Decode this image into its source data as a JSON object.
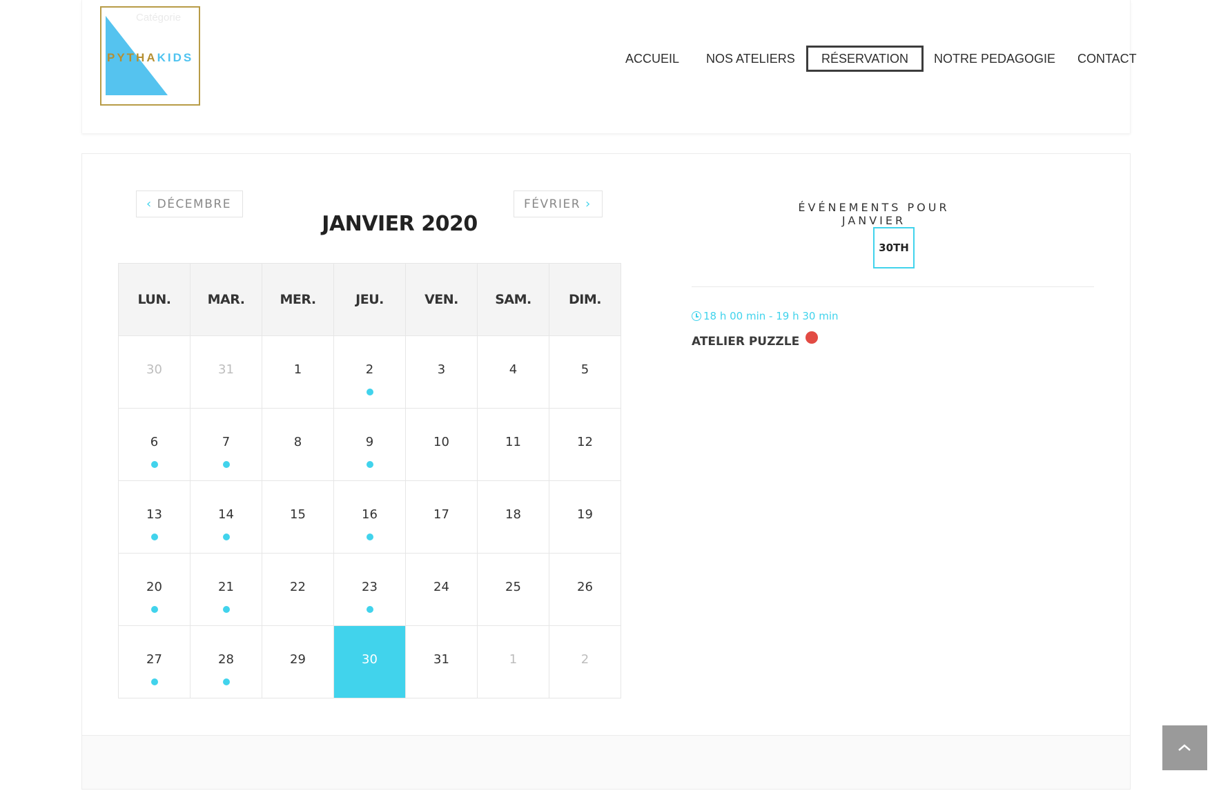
{
  "logo": {
    "faint_text": "Catégorie",
    "text_gold": "PYTHA",
    "text_blue": "KIDS"
  },
  "nav": {
    "items": [
      {
        "label": "ACCUEIL"
      },
      {
        "label": "NOS ATELIERS"
      },
      {
        "label": "RÉSERVATION"
      },
      {
        "label": "NOTRE PEDAGOGIE"
      },
      {
        "label": "CONTACT"
      }
    ]
  },
  "calendar": {
    "prev_label": "DÉCEMBRE",
    "next_label": "FÉVRIER",
    "title": "JANVIER 2020",
    "weekdays": [
      "LUN.",
      "MAR.",
      "MER.",
      "JEU.",
      "VEN.",
      "SAM.",
      "DIM."
    ],
    "weeks": [
      [
        {
          "d": "30",
          "muted": true
        },
        {
          "d": "31",
          "muted": true
        },
        {
          "d": "1"
        },
        {
          "d": "2",
          "dot": true
        },
        {
          "d": "3"
        },
        {
          "d": "4"
        },
        {
          "d": "5"
        }
      ],
      [
        {
          "d": "6",
          "dot": true
        },
        {
          "d": "7",
          "dot": true
        },
        {
          "d": "8"
        },
        {
          "d": "9",
          "dot": true
        },
        {
          "d": "10"
        },
        {
          "d": "11"
        },
        {
          "d": "12"
        }
      ],
      [
        {
          "d": "13",
          "dot": true
        },
        {
          "d": "14",
          "dot": true
        },
        {
          "d": "15"
        },
        {
          "d": "16",
          "dot": true
        },
        {
          "d": "17"
        },
        {
          "d": "18"
        },
        {
          "d": "19"
        }
      ],
      [
        {
          "d": "20",
          "dot": true
        },
        {
          "d": "21",
          "dot": true
        },
        {
          "d": "22"
        },
        {
          "d": "23",
          "dot": true
        },
        {
          "d": "24"
        },
        {
          "d": "25"
        },
        {
          "d": "26"
        }
      ],
      [
        {
          "d": "27",
          "dot": true
        },
        {
          "d": "28",
          "dot": true
        },
        {
          "d": "29"
        },
        {
          "d": "30",
          "selected": true
        },
        {
          "d": "31"
        },
        {
          "d": "1",
          "muted": true
        },
        {
          "d": "2",
          "muted": true
        }
      ]
    ]
  },
  "events": {
    "title": "ÉVÉNEMENTS POUR JANVIER",
    "day_badge": "30TH",
    "items": [
      {
        "time": "18 h 00 min - 19 h 30 min",
        "name": "ATELIER PUZZLE"
      }
    ]
  },
  "colors": {
    "accent": "#41d3ec",
    "gold": "#b79b46",
    "event_dot": "#e24b44"
  },
  "icons": {
    "prev": "chevron-left-icon",
    "next": "chevron-right-icon",
    "clock": "clock-icon",
    "scroll_top": "chevron-up-icon"
  }
}
